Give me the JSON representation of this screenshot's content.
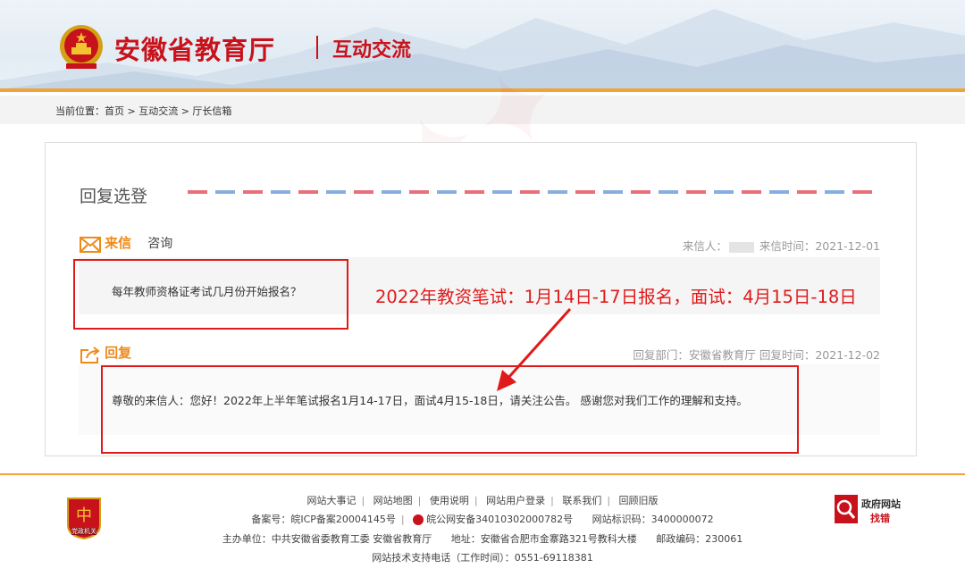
{
  "header": {
    "site_title": "安徽省教育厅",
    "section_title": "互动交流"
  },
  "breadcrumb": {
    "text": "当前位置：首页 > 互动交流 > 厅长信箱"
  },
  "card": {
    "title": "回复选登",
    "letter": {
      "label": "来信",
      "type": "咨询",
      "sender_label": "来信人：",
      "time_label": "来信时间：",
      "time": "2021-12-01",
      "content": "每年教师资格证考试几月份开始报名？"
    },
    "reply": {
      "label": "回复",
      "dept_label": "回复部门：",
      "dept": "安徽省教育厅",
      "time_label": "回复时间：",
      "time": "2021-12-02",
      "content": "尊敬的来信人：您好！2022年上半年笔试报名1月14-17日，面试4月15-18日，请关注公告。 感谢您对我们工作的理解和支持。"
    }
  },
  "annotation": {
    "text": "2022年教资笔试：1月14日-17日报名，面试：4月15日-18日",
    "color": "#e01a1a"
  },
  "footer": {
    "links": [
      "网站大事记",
      "网站地图",
      "使用说明",
      "网站用户登录",
      "联系我们",
      "回顾旧版"
    ],
    "icp": "备案号：皖ICP备案20004145号",
    "police": "皖公网安备34010302000782号",
    "site_id": "网站标识码：3400000072",
    "host": "主办单位：中共安徽省委教育工委 安徽省教育厅",
    "address": "地址：安徽省合肥市金寨路321号教科大楼",
    "postcode": "邮政编码：230061",
    "support": "网站技术支持电话（工作时间）：0551-69118381",
    "badge_left": "党政机关",
    "badge_right_top": "政府网站",
    "badge_right_bottom": "找错"
  },
  "colors": {
    "brand_red": "#c8121b",
    "accent_orange": "#f0a33a",
    "label_orange": "#ee8a1a"
  }
}
